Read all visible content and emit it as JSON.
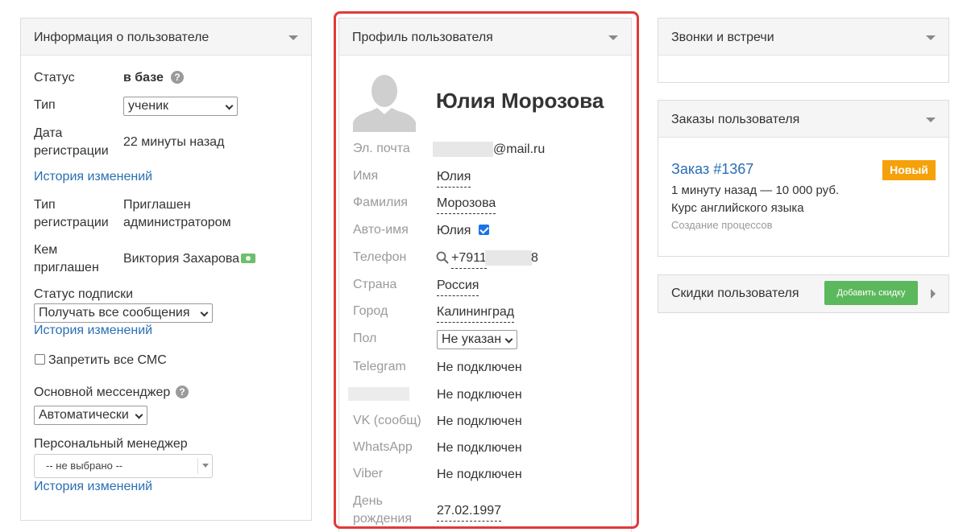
{
  "left_panel": {
    "title": "Информация о пользователе",
    "status_label": "Статус",
    "status_value": "в базе",
    "help_glyph": "?",
    "type_label": "Тип",
    "type_value": "ученик",
    "reg_date_label_1": "Дата",
    "reg_date_label_2": "регистрации",
    "reg_date_value": "22 минуты назад",
    "history_link_1": "История изменений",
    "reg_type_label_1": "Тип",
    "reg_type_label_2": "регистрации",
    "reg_type_value_1": "Приглашен",
    "reg_type_value_2": "администратором",
    "invited_label_1": "Кем",
    "invited_label_2": "приглашен",
    "invited_value": "Виктория Захарова",
    "subscription_label": "Статус подписки",
    "subscription_value": "Получать все сообщения",
    "history_link_2": "История изменений",
    "block_sms_label": "Запретить все СМС",
    "messenger_label": "Основной мессенджер",
    "messenger_value": "Автоматически",
    "manager_label": "Персональный менеджер",
    "manager_value": "-- не выбрано --",
    "history_link_3": "История изменений"
  },
  "profile_panel": {
    "title": "Профиль пользователя",
    "name": "Юлия Морозова",
    "fields": {
      "email_label": "Эл. почта",
      "email_value": "@mail.ru",
      "first_name_label": "Имя",
      "first_name_value": "Юлия",
      "last_name_label": "Фамилия",
      "last_name_value": "Морозова",
      "auto_name_label": "Авто-имя",
      "auto_name_value": "Юлия",
      "phone_label": "Телефон",
      "phone_value": "+7911",
      "phone_tail": "8",
      "country_label": "Страна",
      "country_value": "Россия",
      "city_label": "Город",
      "city_value": "Калининград",
      "gender_label": "Пол",
      "gender_value": "Не указан",
      "telegram_label": "Telegram",
      "telegram_value": "Не подключен",
      "hidden_value": "Не подключен",
      "vk_label": "VK (сообщ)",
      "vk_value": "Не подключен",
      "whatsapp_label": "WhatsApp",
      "whatsapp_value": "Не подключен",
      "viber_label": "Viber",
      "viber_value": "Не подключен",
      "birthday_label_1": "День",
      "birthday_label_2": "рождения",
      "birthday_value": "27.02.1997"
    }
  },
  "calls_panel": {
    "title": "Звонки и встречи"
  },
  "orders_panel": {
    "title": "Заказы пользователя",
    "order_link": "Заказ #1367",
    "order_badge": "Новый",
    "order_meta": "1 минуту назад — 10 000 руб.",
    "order_course": "Курс английского языка",
    "order_source": "Создание процессов"
  },
  "discounts_panel": {
    "title": "Скидки пользователя",
    "add_button": "Добавить скидку"
  },
  "colors": {
    "link": "#2a6fb3",
    "badge": "#f5a10a",
    "button": "#5cb85c",
    "highlight": "#e03a3a"
  },
  "icons": [
    "caret-down-icon",
    "help-icon",
    "chevron-down-icon",
    "money-icon",
    "search-icon",
    "avatar-icon",
    "checkbox-icon",
    "caret-right-icon"
  ]
}
